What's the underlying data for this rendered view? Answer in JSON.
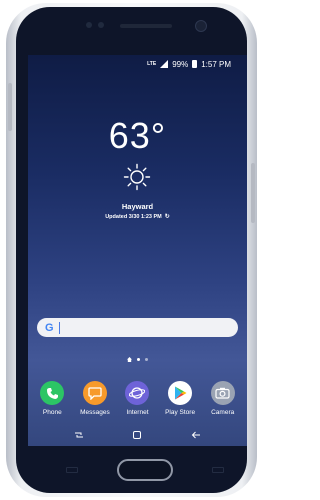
{
  "status_bar": {
    "network": "LTE",
    "battery": "99%",
    "time": "1:57 PM"
  },
  "weather": {
    "temperature": "63°",
    "icon": "sun-icon",
    "city": "Hayward",
    "updated": "Updated 3/30 1:23 PM"
  },
  "search": {
    "logo": "G",
    "placeholder": ""
  },
  "dock": [
    {
      "label": "Phone",
      "icon": "phone-icon",
      "color": "#2cc565"
    },
    {
      "label": "Messages",
      "icon": "messages-icon",
      "color": "#f79a2b"
    },
    {
      "label": "Internet",
      "icon": "internet-icon",
      "color": "#6e63d8"
    },
    {
      "label": "Play Store",
      "icon": "play-store-icon",
      "color": "#ffffff"
    },
    {
      "label": "Camera",
      "icon": "camera-icon",
      "color": "#9aa3b3"
    }
  ],
  "nav": {
    "recents": "recents-icon",
    "home": "home-icon",
    "back": "back-icon"
  }
}
